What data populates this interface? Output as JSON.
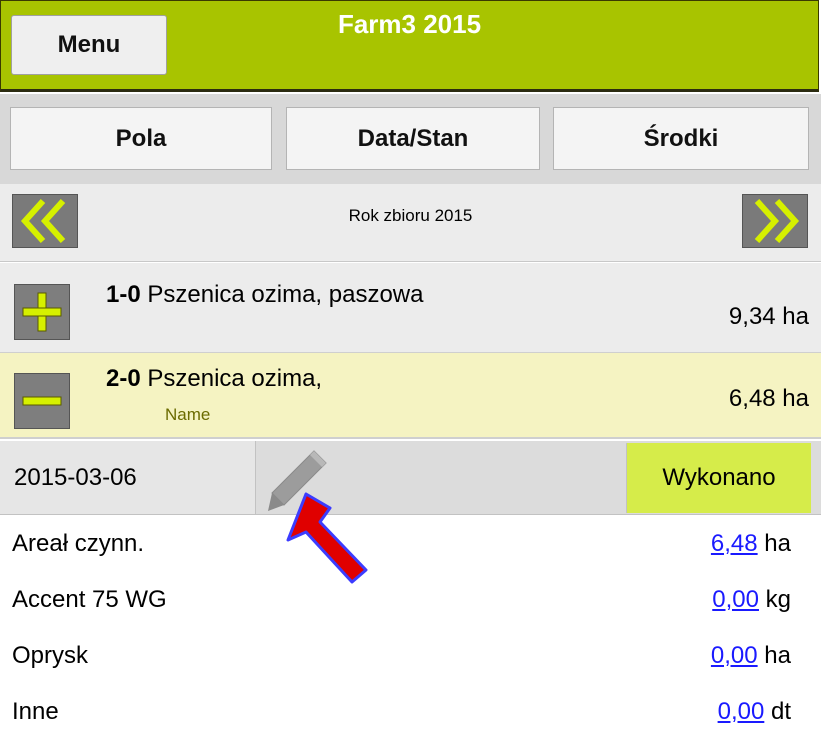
{
  "header": {
    "menu_label": "Menu",
    "title": "Farm3 2015"
  },
  "tabs": [
    {
      "label": "Pola"
    },
    {
      "label": "Data/Stan"
    },
    {
      "label": "Środki"
    }
  ],
  "year_nav": {
    "label": "Rok zbioru 2015",
    "prev_icon": "double-chevron-left-icon",
    "next_icon": "double-chevron-right-icon"
  },
  "fields": [
    {
      "code": "1-0",
      "name": "Pszenica ozima, paszowa",
      "sub": "",
      "area": "9,34 ha",
      "toggle": "plus",
      "expanded": false
    },
    {
      "code": "2-0",
      "name": "Pszenica ozima,",
      "sub": "Name",
      "area": "6,48 ha",
      "toggle": "minus",
      "expanded": true
    }
  ],
  "operation": {
    "date": "2015-03-06",
    "status": "Wykonano",
    "edit_icon": "pencil-icon"
  },
  "details": [
    {
      "label": "Areał czynn.",
      "value": "6,48",
      "unit": "ha"
    },
    {
      "label": "Accent 75 WG",
      "value": "0,00",
      "unit": "kg"
    },
    {
      "label": "Oprysk",
      "value": "0,00",
      "unit": "ha"
    },
    {
      "label": "Inne",
      "value": "0,00",
      "unit": "dt"
    }
  ],
  "colors": {
    "header": "#a8c400",
    "accent_icon": "#d6f000",
    "status": "#d6ec4a",
    "selected_row": "#f5f3c2",
    "annotation": "#e00000"
  }
}
